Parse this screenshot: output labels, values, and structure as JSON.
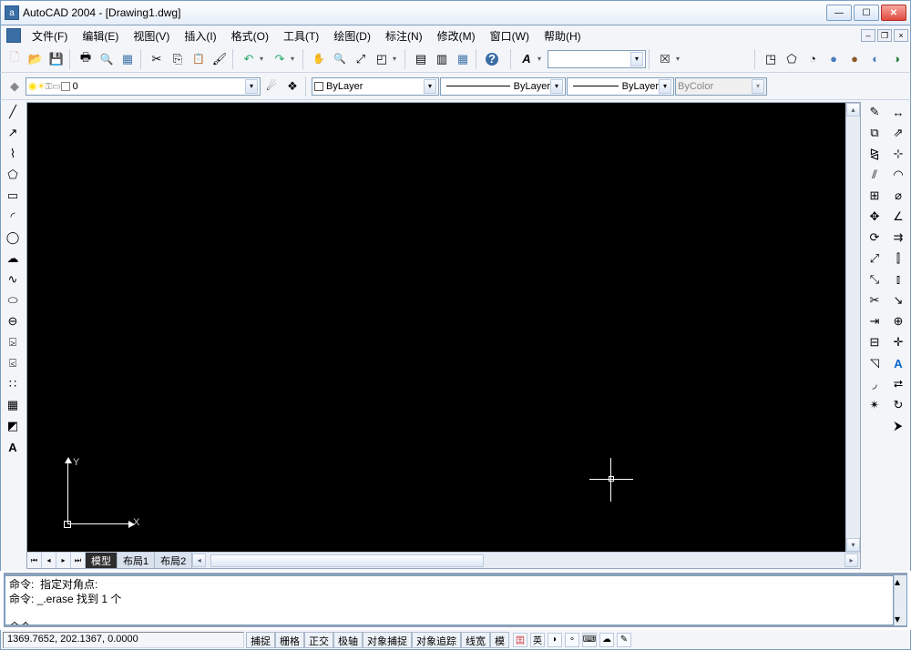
{
  "title": "AutoCAD 2004 - [Drawing1.dwg]",
  "app_icon_letter": "a",
  "menu": [
    "文件(F)",
    "编辑(E)",
    "视图(V)",
    "插入(I)",
    "格式(O)",
    "工具(T)",
    "绘图(D)",
    "标注(N)",
    "修改(M)",
    "窗口(W)",
    "帮助(H)"
  ],
  "layer": {
    "current": "0"
  },
  "props": {
    "color_label": "ByLayer",
    "linetype_label": "ByLayer",
    "lineweight_label": "ByLayer",
    "plotstyle_label": "ByColor"
  },
  "tabs": {
    "active": "模型",
    "layout1": "布局1",
    "layout2": "布局2"
  },
  "ucs": {
    "x": "X",
    "y": "Y"
  },
  "cmd": {
    "line1": "命令:  指定对角点:",
    "line2": "命令: _.erase 找到 1 个",
    "line3": "命令:"
  },
  "status": {
    "coords": "1369.7652, 202.1367, 0.0000",
    "toggles": [
      "捕捉",
      "栅格",
      "正交",
      "极轴",
      "对象捕捉",
      "对象追踪",
      "线宽",
      "模"
    ],
    "ime": "英"
  }
}
